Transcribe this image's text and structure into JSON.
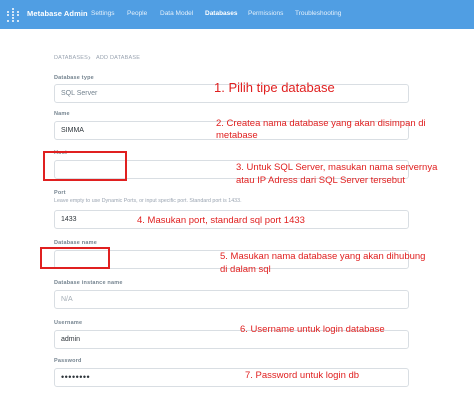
{
  "app": {
    "brand": "Metabase Admin",
    "nav": [
      "Settings",
      "People",
      "Data Model",
      "Databases",
      "Permissions",
      "Troubleshooting"
    ],
    "active_nav": "Databases"
  },
  "breadcrumb": {
    "parent": "DATABASES",
    "separator": "›",
    "current": "ADD DATABASE"
  },
  "form": {
    "db_type": {
      "label": "Database type",
      "value": "SQL Server"
    },
    "name": {
      "label": "Name",
      "value": "SIMMA"
    },
    "host": {
      "label": "Host",
      "value": ""
    },
    "port": {
      "label": "Port",
      "hint": "Leave empty to use Dynamic Ports, or input specific port. Standard port is 1433.",
      "value": "1433"
    },
    "db_name": {
      "label": "Database name",
      "value": ""
    },
    "instance": {
      "label": "Database instance name",
      "placeholder": "N/A"
    },
    "username": {
      "label": "Username",
      "value": "admin"
    },
    "password": {
      "label": "Password",
      "value": "••••••••"
    }
  },
  "annotations": {
    "a1": "1. Pilih tipe database",
    "a2_line1": "2. Createa nama database yang akan disimpan di",
    "a2_line2": "metabase",
    "a3_line1": "3. Untuk SQL Server, masukan nama servernya",
    "a3_line2": "atau IP Adress dari SQL Server tersebut",
    "a4": "4. Masukan port, standard sql port 1433",
    "a5_line1": "5. Masukan nama database yang akan dihubung",
    "a5_line2": "di dalam sql",
    "a6": "6. Username untuk login database",
    "a7": "7. Password untuk login db"
  },
  "colors": {
    "nav_bg": "#509ee3",
    "annotation": "#e02020"
  }
}
